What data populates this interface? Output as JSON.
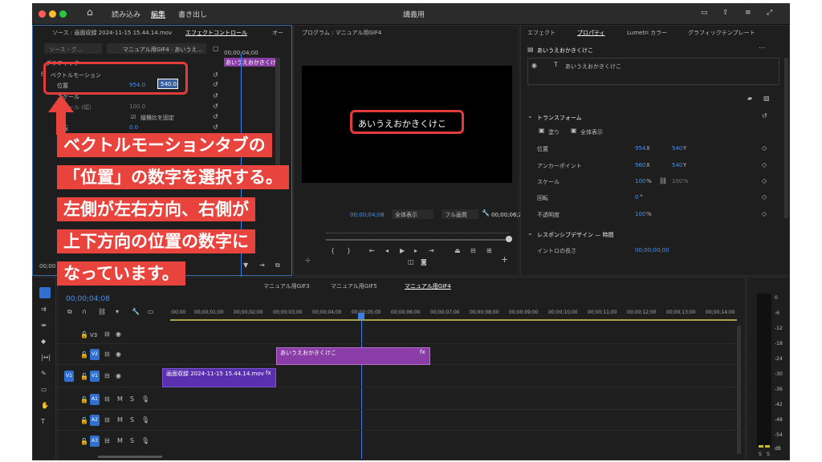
{
  "titlebar": {
    "menu": [
      "読み込み",
      "編集",
      "書き出し"
    ],
    "project": "講義用"
  },
  "source_panel": {
    "tabs": [
      "ソース : 画面収録 2024-11-15 15.44.14.mov",
      "エフェクトコントロール",
      "オー"
    ],
    "source_dropdown": "ソース・グ...",
    "clip_dropdown": "マニュアル用GIF4 · あいうえ...",
    "section": "グラフィック",
    "effect_name": "ベクトルモーション",
    "timecode": "00;00;04;00",
    "mini_clip": "あいうえおかきくけ",
    "rows": [
      {
        "label": "位置",
        "v1": "954.0",
        "v2": "540.0"
      },
      {
        "label": "スケール",
        "v1": "100.0",
        "v2": ""
      },
      {
        "label": "スケール (幅)",
        "v1": "100.0",
        "v2": ""
      },
      {
        "label": "縦横比を固定",
        "v1": "",
        "v2": ""
      },
      {
        "label": "回転",
        "v1": "0.0",
        "v2": ""
      }
    ],
    "timestamp_bottom": "00;00"
  },
  "program_panel": {
    "tab": "プログラム : マニュアル用GIF4",
    "overlay_text": "あいうえおかきくけこ",
    "timecode": "00;00;04;08",
    "fit": "全体表示",
    "quality": "フル画質",
    "duration": "00;00;06;25"
  },
  "properties_panel": {
    "tabs": [
      "エフェクト",
      "プロパティ",
      "Lumetri カラー",
      "グラフィックテンプレート"
    ],
    "layer_title": "あいうえおかきくけこ",
    "layer_item": "あいうえおかきくけこ",
    "transform_title": "トランスフォーム",
    "fill_label": "塗り",
    "fit_label": "全体表示",
    "rows": [
      {
        "label": "位置",
        "v1": "954",
        "u1": "X",
        "v2": "540",
        "u2": "Y"
      },
      {
        "label": "アンカーポイント",
        "v1": "960",
        "u1": "X",
        "v2": "540",
        "u2": "Y"
      },
      {
        "label": "スケール",
        "v1": "100",
        "u1": "%",
        "v2": "100",
        "u2": "%"
      },
      {
        "label": "回転",
        "v1": "0",
        "u1": "°",
        "v2": "",
        "u2": ""
      },
      {
        "label": "不透明度",
        "v1": "100",
        "u1": "%",
        "v2": "",
        "u2": ""
      }
    ],
    "responsive_title": "レスポンシブデザイン — 時間",
    "intro_label": "イントロの長さ",
    "intro_value": "00;00;00;00"
  },
  "timeline": {
    "tabs": [
      "マニュアル用GIF3",
      "マニュアル用GIF5",
      "マニュアル用GIF4"
    ],
    "timecode": "00;00;04;08",
    "ruler": [
      ":00;00",
      "00;00;01;00",
      "00;00;02;00",
      "00;00;03;00",
      "00;00;04;00",
      "00;00;05;00",
      "00;00;06;00",
      "00;00;07;00",
      "00;00;08;00",
      "00;00;09;00",
      "00;00;10;00",
      "00;00;11;00",
      "00;00;12;00",
      "00;00;13;00",
      "00;00;14;00"
    ],
    "tracks": [
      "V3",
      "V2",
      "V1",
      "A1",
      "A2",
      "A3"
    ],
    "source_patch": "V1",
    "clips": {
      "v2": "あいうえおかきくけこ",
      "v1": "画面収録 2024-11-15 15.44.14.mov",
      "fx": "fx"
    }
  },
  "vu_meter": {
    "scale": [
      "0",
      "-6",
      "-12",
      "-18",
      "-24",
      "-30",
      "-36",
      "-42",
      "-48",
      "-54",
      "dB"
    ],
    "solo": [
      "S",
      "S"
    ]
  },
  "callout": {
    "lines": [
      "ベクトルモーションタブの",
      "「位置」の数字を選択する。",
      "左側が左右方向、右側が",
      "上下方向の位置の数字に",
      "なっています。"
    ]
  },
  "colors": {
    "accent": "#4f8fe6",
    "highlight": "#e23b3b",
    "callout_bg": "#e8433c",
    "clip_v2": "#8a3da6",
    "clip_v1": "#5a2fb0"
  }
}
